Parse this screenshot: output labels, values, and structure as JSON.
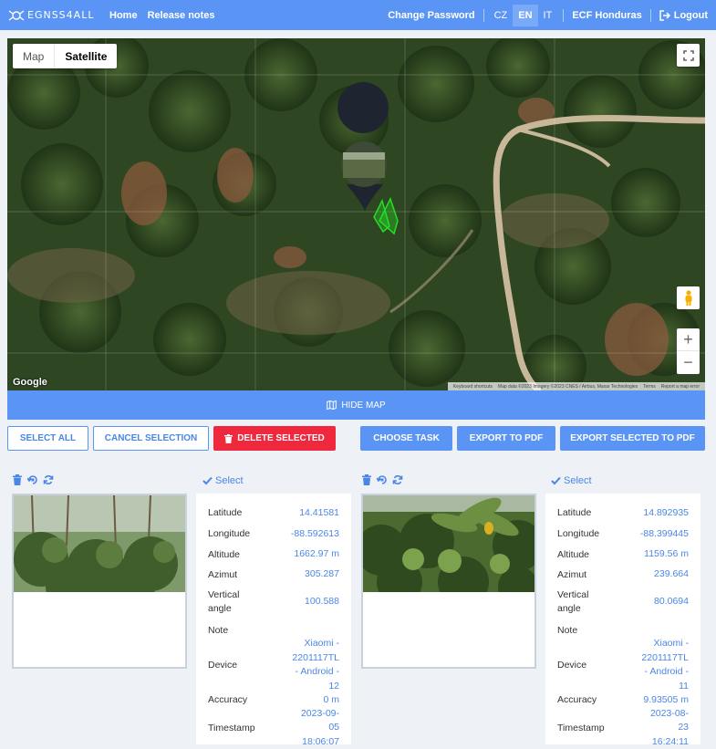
{
  "app": {
    "brand": "EGNSS4ALL"
  },
  "nav": {
    "home": "Home",
    "release_notes": "Release notes",
    "change_password": "Change Password",
    "languages": [
      "CZ",
      "EN",
      "IT"
    ],
    "active_language": "EN",
    "organization": "ECF Honduras",
    "logout": "Logout"
  },
  "map": {
    "type_map": "Map",
    "type_satellite": "Satellite",
    "active_type": "Satellite",
    "logo": "Google",
    "attribution": [
      "Keyboard shortcuts",
      "Map data ©2023 Imagery ©2023 CNES / Airbus, Maxar Technologies",
      "Terms",
      "Report a map error"
    ],
    "zoom_in": "+",
    "zoom_out": "−"
  },
  "hide_map": "HIDE MAP",
  "actions": {
    "select_all": "SELECT ALL",
    "cancel_selection": "CANCEL SELECTION",
    "delete_selected": "DELETE SELECTED",
    "choose_task": "CHOOSE TASK",
    "export_pdf": "EXPORT TO PDF",
    "export_selected_pdf": "EXPORT SELECTED TO PDF"
  },
  "colors": {
    "primary": "#5a95f5",
    "danger": "#f0283e",
    "link": "#4a86e8"
  },
  "photos": [
    {
      "select_label": "Select",
      "fields": [
        {
          "label": "Latitude",
          "value": "14.41581"
        },
        {
          "label": "Longitude",
          "value": "-88.592613"
        },
        {
          "label": "Altitude",
          "value": "1662.97 m"
        },
        {
          "label": "Azimut",
          "value": "305.287"
        },
        {
          "label": "Vertical angle",
          "value": "100.588"
        },
        {
          "label": "Note",
          "value": ""
        },
        {
          "label": "Device",
          "value": "Xiaomi - 2201117TL - Android - 12"
        },
        {
          "label": "Accuracy",
          "value": "0 m"
        },
        {
          "label": "Timestamp",
          "value": "2023-09-05 18:06:07"
        }
      ]
    },
    {
      "select_label": "Select",
      "fields": [
        {
          "label": "Latitude",
          "value": "14.892935"
        },
        {
          "label": "Longitude",
          "value": "-88.399445"
        },
        {
          "label": "Altitude",
          "value": "1159.56 m"
        },
        {
          "label": "Azimut",
          "value": "239.664"
        },
        {
          "label": "Vertical angle",
          "value": "80.0694"
        },
        {
          "label": "Note",
          "value": ""
        },
        {
          "label": "Device",
          "value": "Xiaomi - 2201117TL - Android - 11"
        },
        {
          "label": "Accuracy",
          "value": "9.93505 m"
        },
        {
          "label": "Timestamp",
          "value": "2023-08-23 16:24:11"
        }
      ]
    }
  ]
}
